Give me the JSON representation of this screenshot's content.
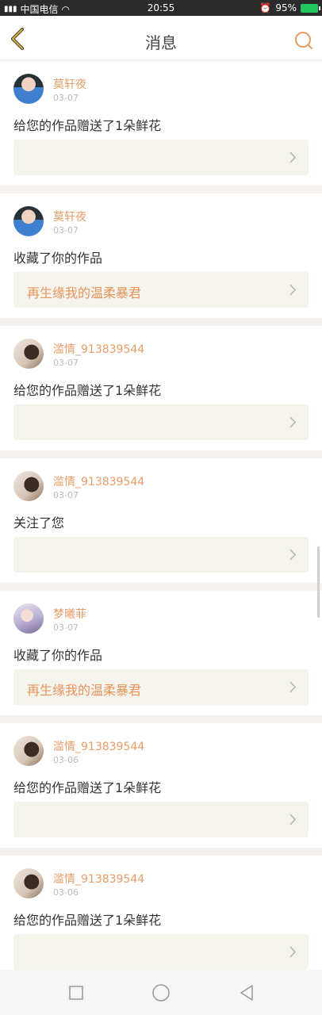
{
  "status_bar": {
    "carrier": "中国电信",
    "time": "20:55",
    "battery": "95%"
  },
  "nav": {
    "title": "消息",
    "icons": {
      "back": "back-arrow-icon",
      "search": "search-icon"
    }
  },
  "colors": {
    "accent": "#e89c66",
    "card_bg": "#ffffff",
    "work_bg": "#f4f3ec"
  },
  "messages": [
    {
      "username": "莫轩夜",
      "date": "03-07",
      "action": "给您的作品赠送了1朵鲜花",
      "work_title": ""
    },
    {
      "username": "莫轩夜",
      "date": "03-07",
      "action": "收藏了你的作品",
      "work_title": "再生缘我的温柔暴君"
    },
    {
      "username": "滥情_913839544",
      "date": "03-07",
      "action": "给您的作品赠送了1朵鲜花",
      "work_title": ""
    },
    {
      "username": "滥情_913839544",
      "date": "03-07",
      "action": "关注了您",
      "work_title": ""
    },
    {
      "username": "梦曦菲",
      "date": "03-07",
      "action": "收藏了你的作品",
      "work_title": "再生缘我的温柔暴君"
    },
    {
      "username": "滥情_913839544",
      "date": "03-06",
      "action": "给您的作品赠送了1朵鲜花",
      "work_title": ""
    },
    {
      "username": "滥情_913839544",
      "date": "03-06",
      "action": "给您的作品赠送了1朵鲜花",
      "work_title": ""
    }
  ],
  "bottom_nav": [
    "recent-apps-icon",
    "home-icon",
    "back-icon"
  ]
}
